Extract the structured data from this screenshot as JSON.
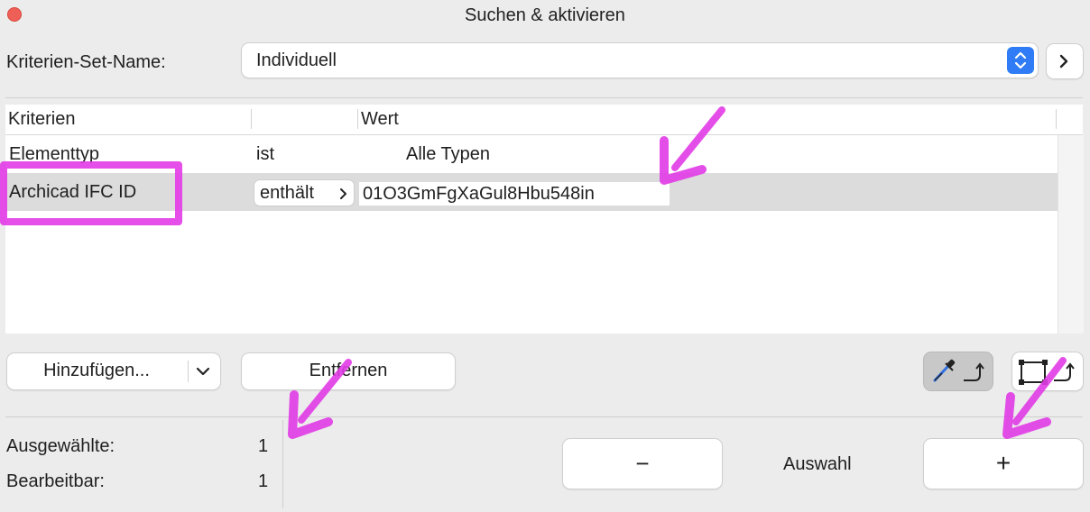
{
  "window": {
    "title": "Suchen & aktivieren"
  },
  "criteria_set": {
    "label": "Kriterien-Set-Name:",
    "value": "Individuell"
  },
  "table": {
    "headers": [
      "Kriterien",
      "",
      "Wert"
    ],
    "rows": [
      {
        "criterion": "Elementtyp",
        "operator": "ist",
        "value": "Alle Typen"
      },
      {
        "criterion": "Archicad IFC ID",
        "operator": "enthält",
        "value": "01O3GmFgXaGul8Hbu548in"
      }
    ]
  },
  "buttons": {
    "add": "Hinzufügen...",
    "remove": "Entfernen",
    "minus": "−",
    "plus": "+"
  },
  "selection": {
    "label": "Auswahl"
  },
  "stats": {
    "selected_label": "Ausgewählte:",
    "selected_value": "1",
    "editable_label": "Bearbeitbar:",
    "editable_value": "1"
  },
  "colors": {
    "accent": "#2f7cf6",
    "annotation": "#e23be6"
  }
}
